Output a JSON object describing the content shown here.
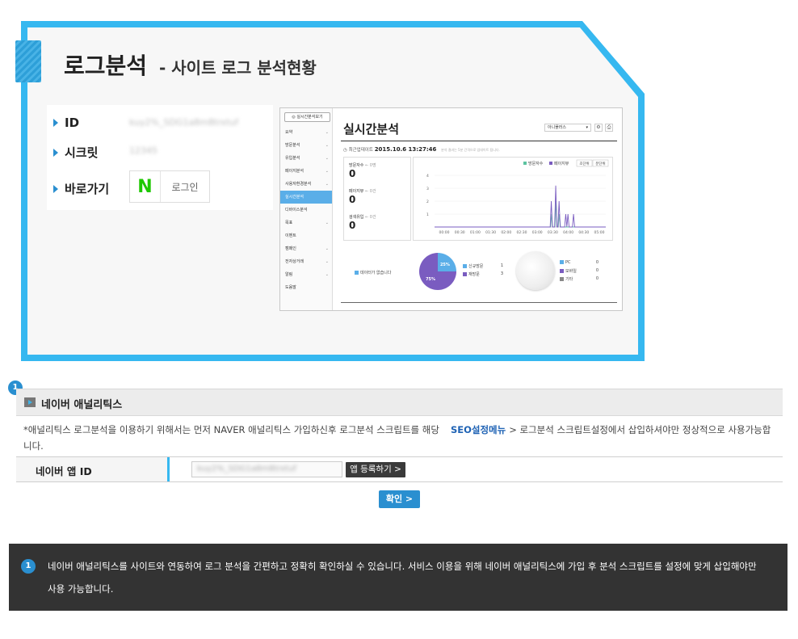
{
  "panel": {
    "title": "로그분석",
    "subtitle": "- 사이트 로그 분석현황",
    "fields": {
      "id_label": "ID",
      "id_value": "kuy2%_SDG1a8m8trxtuf",
      "secret_label": "시크릿",
      "secret_value": "12345",
      "shortcut_label": "바로가기"
    },
    "naver_login": {
      "logo_letter": "N",
      "label": "로그인"
    }
  },
  "dashboard": {
    "side_button": "실시간분석보기",
    "menu": [
      {
        "label": "요약",
        "chevron": true
      },
      {
        "label": "방문분석",
        "chevron": true
      },
      {
        "label": "유입분석",
        "chevron": true
      },
      {
        "label": "페이지분석",
        "chevron": true
      },
      {
        "label": "사용자환경분석",
        "chevron": true
      },
      {
        "label": "실시간분석",
        "chevron": false,
        "active": true
      },
      {
        "label": "디바이스분석",
        "chevron": false
      },
      {
        "label": "목표",
        "chevron": true
      },
      {
        "label": "이벤트",
        "chevron": false
      },
      {
        "label": "캠페인",
        "chevron": true
      },
      {
        "label": "전자상거래",
        "chevron": true
      },
      {
        "label": "알림",
        "chevron": true
      },
      {
        "label": "도움말",
        "chevron": false
      }
    ],
    "title": "실시간분석",
    "site_select": "아니플러스",
    "update_label": "최근업데이트",
    "update_time": "2015.10.6 13:27:46",
    "update_note": "분석 결과는 5분 간격으로 업데이트 됩니다.",
    "stats": [
      {
        "label": "방문자수",
        "compare": "← 0명",
        "value": "0"
      },
      {
        "label": "페이지뷰",
        "compare": "← 0건",
        "value": "0"
      },
      {
        "label": "검색유입",
        "compare": "← 0건",
        "value": "0"
      }
    ],
    "legend": [
      {
        "name": "방문자수",
        "color": "#5cc3a0"
      },
      {
        "name": "페이지뷰",
        "color": "#7a5cc0"
      }
    ],
    "view_buttons": [
      "초단위",
      "분단위"
    ],
    "no_data_label": "데이터가 없습니다",
    "pie_visit_labels": [
      {
        "name": "신규방문",
        "value": "1",
        "color": "#5aaee8"
      },
      {
        "name": "재방문",
        "value": "3",
        "color": "#7a5cc0"
      }
    ],
    "pie_visit_pct": [
      "25%",
      "75%"
    ],
    "device_labels": [
      {
        "name": "PC",
        "value": "0",
        "color": "#5aaee8"
      },
      {
        "name": "모바일",
        "value": "0",
        "color": "#7a5cc0"
      },
      {
        "name": "기타",
        "value": "0",
        "color": "#888888"
      }
    ],
    "chart_data": {
      "type": "line",
      "x": [
        "00:00",
        "00:30",
        "01:00",
        "01:30",
        "02:00",
        "02:30",
        "03:00",
        "03:30",
        "04:00",
        "04:30",
        "05:00"
      ],
      "ylim": [
        0,
        4
      ],
      "yticks": [
        "4",
        "3",
        "2",
        "1"
      ],
      "series": [
        {
          "name": "방문자수",
          "color": "#5cc3a0",
          "values": [
            0,
            0,
            0,
            0,
            0,
            0,
            0,
            0,
            0,
            0,
            0,
            0,
            0,
            0,
            0,
            0,
            0,
            0,
            0,
            0,
            0,
            0,
            0,
            0,
            0,
            0,
            0,
            0,
            0,
            0,
            0,
            0,
            0,
            0,
            0,
            0,
            0,
            0,
            0,
            0,
            0,
            0,
            0,
            0,
            0,
            0,
            0,
            0,
            0,
            0,
            0,
            0,
            0,
            0,
            0,
            0,
            0,
            0,
            0,
            0,
            0,
            0,
            0,
            0,
            0,
            0,
            0,
            0,
            0,
            0,
            0,
            0,
            0,
            0,
            0,
            0,
            0,
            0,
            0,
            0,
            0,
            0,
            0,
            0,
            0,
            0,
            0,
            0,
            0,
            0,
            0,
            0,
            0,
            0,
            0,
            0,
            0,
            0,
            0,
            0,
            0,
            0,
            0,
            0,
            0,
            0,
            1,
            0,
            0,
            0,
            2,
            0,
            0,
            1,
            0,
            0,
            0,
            0,
            0,
            0,
            0,
            0,
            0,
            0,
            0,
            0,
            0,
            0,
            0,
            0,
            0,
            0,
            0,
            0,
            0,
            0,
            0,
            0,
            0,
            0,
            0,
            0,
            0,
            0,
            0,
            0,
            0,
            0,
            0,
            0,
            0,
            0,
            0,
            0,
            0,
            0
          ]
        },
        {
          "name": "페이지뷰",
          "color": "#7a5cc0",
          "values": [
            0,
            0,
            0,
            0,
            0,
            0,
            0,
            0,
            0,
            0,
            0,
            0,
            0,
            0,
            0,
            0,
            0,
            0,
            0,
            0,
            0,
            0,
            0,
            0,
            0,
            0,
            0,
            0,
            0,
            0,
            0,
            0,
            0,
            0,
            0,
            0,
            0,
            0,
            0,
            0,
            0,
            0,
            0,
            0,
            0,
            0,
            0,
            0,
            0,
            0,
            0,
            0,
            0,
            0,
            0,
            0,
            0,
            0,
            0,
            0,
            0,
            0,
            0,
            0,
            0,
            0,
            0,
            0,
            0,
            0,
            0,
            0,
            0,
            0,
            0,
            0,
            0,
            0,
            0,
            0,
            0,
            0,
            0,
            0,
            0,
            0,
            0,
            0,
            0,
            0,
            0,
            0,
            0,
            0,
            0,
            0,
            0,
            0,
            0,
            0,
            0,
            0,
            0,
            0,
            0,
            2,
            0,
            0,
            0,
            3.2,
            0,
            0,
            2,
            0,
            0,
            0,
            0,
            0,
            1,
            0,
            1,
            0,
            0,
            0,
            0,
            1,
            0,
            0,
            0,
            0,
            0,
            0,
            0,
            0,
            0,
            0,
            0,
            0,
            0,
            0,
            0,
            0,
            0,
            0,
            0,
            0,
            0,
            0,
            0,
            0,
            0,
            0,
            0,
            0,
            0
          ]
        }
      ]
    }
  },
  "analytics": {
    "step": "1",
    "title": "네이버 애널리틱스",
    "desc_before": "*애널리틱스 로그분석을 이용하기 위해서는 먼저 NAVER 애널리틱스 가입하신후 로그분석 스크립트를 해당",
    "desc_link": "SEO설정메뉴",
    "desc_after": "> 로그분석 스크립트설정에서 삽입하셔야만 정상적으로 사용가능합니다.",
    "app_id_label": "네이버 앱 ID",
    "app_id_value": "kuy2%_SDG1a8m8trxtuf",
    "register_button": "앱 등록하기 >",
    "confirm_button": "확인 >"
  },
  "note": {
    "step": "1",
    "text": "네이버 애널리틱스를 사이트와 연동하여 로그 분석을 간편하고 정확히 확인하실 수 있습니다. 서비스 이용을 위해 네이버 애널리틱스에 가입 후 분석 스크립트를 설정에 맞게 삽입해야만 사용 가능합니다."
  }
}
